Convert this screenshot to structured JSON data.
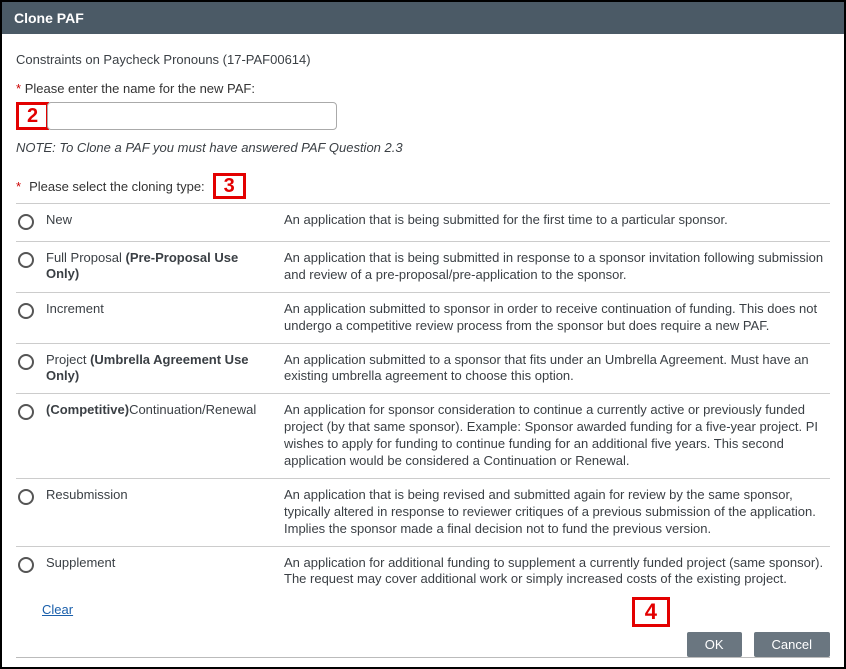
{
  "titlebar": "Clone PAF",
  "doc_title": "Constraints on Paycheck Pronouns  (17-PAF00614)",
  "name_field": {
    "asterisk": "*",
    "label": "Please enter the name for the new PAF:",
    "value": ""
  },
  "note": "NOTE: To Clone a PAF you must have answered PAF Question 2.3",
  "select_label": {
    "asterisk": "*",
    "text": "Please select the cloning type:"
  },
  "options": [
    {
      "label_plain": "New",
      "label_bold": "",
      "description": "An application that is being submitted for the first time to a particular sponsor."
    },
    {
      "label_plain": "Full Proposal ",
      "label_bold": "(Pre-Proposal Use Only)",
      "description": "An application that is being submitted in response to a sponsor invitation following submission and review of a pre-proposal/pre-application to the sponsor."
    },
    {
      "label_plain": "Increment",
      "label_bold": "",
      "description": "An application submitted to sponsor in order to receive continuation of funding. This does not undergo a competitive review process from the sponsor but does require a new PAF."
    },
    {
      "label_plain": "Project ",
      "label_bold": "(Umbrella Agreement Use Only)",
      "description": "An application submitted to a sponsor that fits under an Umbrella Agreement. Must have an existing umbrella agreement to choose this option."
    },
    {
      "label_plain": "",
      "label_bold": "(Competitive)",
      "label_plain_after": "Continuation/Renewal",
      "description": "An application for sponsor consideration to continue a currently active or previously funded project (by that same sponsor). Example: Sponsor awarded funding for a five-year project. PI wishes to apply for funding to continue funding for an additional five years. This second application would be considered a Continuation or Renewal."
    },
    {
      "label_plain": "Resubmission",
      "label_bold": "",
      "description": "An application that is being revised and submitted again for review by the same sponsor, typically altered in response to reviewer critiques of a previous submission of the application. Implies the sponsor made a final decision not to fund the previous version."
    },
    {
      "label_plain": "Supplement",
      "label_bold": "",
      "description": "An application for additional funding to supplement a currently funded project (same sponsor). The request may cover additional work or simply increased costs of the existing project."
    }
  ],
  "clear_link": "Clear",
  "buttons": {
    "ok": "OK",
    "cancel": "Cancel"
  },
  "annotations": {
    "two": "2",
    "three": "3",
    "four": "4"
  }
}
